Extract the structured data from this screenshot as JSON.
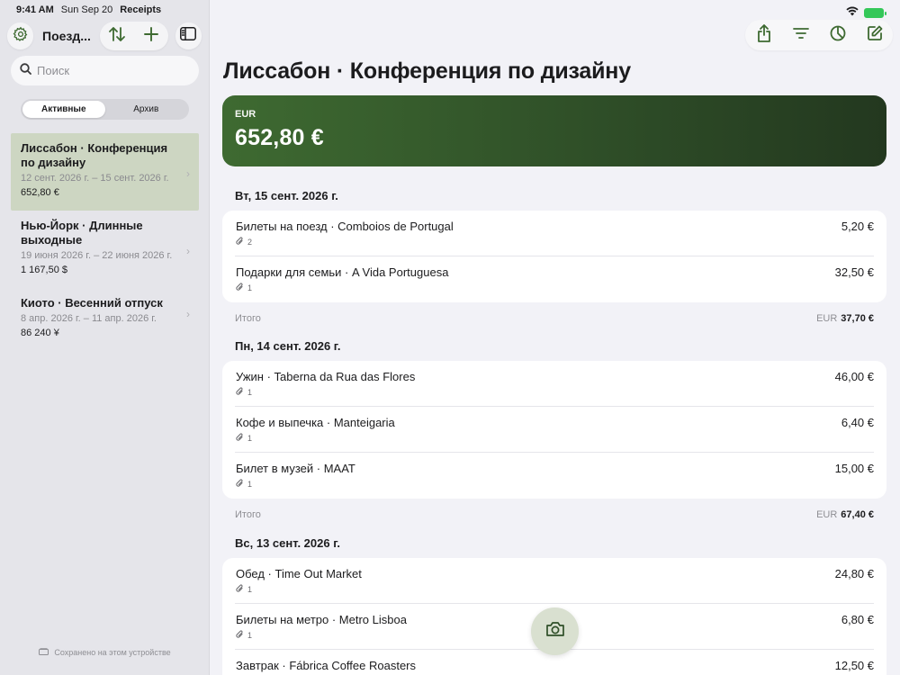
{
  "status": {
    "time": "9:41 AM",
    "date": "Sun Sep 20",
    "app": "Receipts"
  },
  "sidebar": {
    "title": "Поезд...",
    "search_placeholder": "Поиск",
    "segments": [
      "Активные",
      "Архив"
    ],
    "active_segment": "Активные",
    "trips": [
      {
        "name": "Лиссабон · Конференция по дизайну",
        "dates": "12 сент. 2026 г. – 15 сент. 2026 г.",
        "total": "652,80 €",
        "selected": true
      },
      {
        "name": "Нью-Йорк · Длинные выходные",
        "dates": "19 июня 2026 г. – 22 июня 2026 г.",
        "total": "1 167,50 $",
        "selected": false
      },
      {
        "name": "Киото · Весенний отпуск",
        "dates": "8 апр. 2026 г. – 11 апр. 2026 г.",
        "total": "86 240 ¥",
        "selected": false
      }
    ],
    "saved_note": "Сохранено на этом устройстве"
  },
  "main": {
    "title": "Лиссабон · Конференция по дизайну",
    "total_currency": "EUR",
    "total_amount": "652,80 €",
    "days": [
      {
        "header": "Вт, 15 сент. 2026 г.",
        "expenses": [
          {
            "name": "Билеты на поезд · Comboios de Portugal",
            "attachments": "2",
            "amount": "5,20 €"
          },
          {
            "name": "Подарки для семьи · A Vida Portuguesa",
            "attachments": "1",
            "amount": "32,50 €"
          }
        ],
        "subtotal_label": "Итого",
        "subtotal_currency": "EUR",
        "subtotal_amount": "37,70 €"
      },
      {
        "header": "Пн, 14 сент. 2026 г.",
        "expenses": [
          {
            "name": "Ужин · Taberna da Rua das Flores",
            "attachments": "1",
            "amount": "46,00 €"
          },
          {
            "name": "Кофе и выпечка · Manteigaria",
            "attachments": "1",
            "amount": "6,40 €"
          },
          {
            "name": "Билет в музей · MAAT",
            "attachments": "1",
            "amount": "15,00 €"
          }
        ],
        "subtotal_label": "Итого",
        "subtotal_currency": "EUR",
        "subtotal_amount": "67,40 €"
      },
      {
        "header": "Вс, 13 сент. 2026 г.",
        "expenses": [
          {
            "name": "Обед · Time Out Market",
            "attachments": "1",
            "amount": "24,80 €"
          },
          {
            "name": "Билеты на метро · Metro Lisboa",
            "attachments": "1",
            "amount": "6,80 €"
          },
          {
            "name": "Завтрак · Fábrica Coffee Roasters",
            "attachments": "",
            "amount": "12,50 €"
          }
        ]
      }
    ]
  },
  "icons": {
    "settings": "gear-icon",
    "sort": "sort-arrows-icon",
    "add": "plus-icon",
    "sidebar_toggle": "sidebar-icon",
    "search": "search-icon",
    "share": "share-icon",
    "filter": "filter-icon",
    "chart": "pie-chart-icon",
    "edit": "compose-icon",
    "camera": "camera-icon",
    "attachment": "paperclip-icon",
    "device": "device-icon"
  },
  "colors": {
    "accent": "#3e6a31",
    "selected_row": "#cdd6c2",
    "card_dark": "#23381f"
  }
}
